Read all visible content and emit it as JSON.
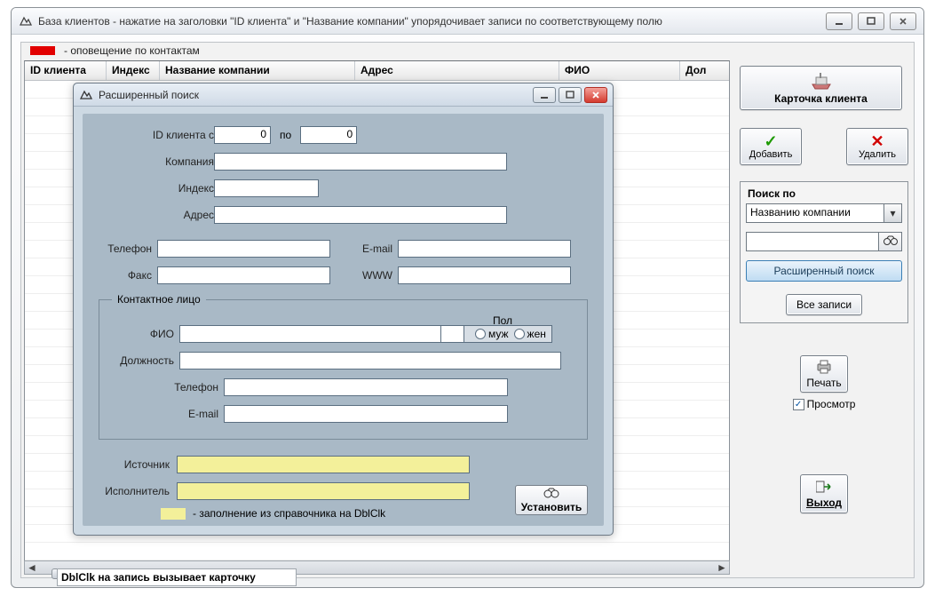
{
  "window": {
    "title": "База клиентов - нажатие на заголовки \"ID клиента\" и \"Название компании\" упорядочивает записи по соответствующему полю"
  },
  "legend": {
    "text": "- оповещение по контактам"
  },
  "grid": {
    "columns": [
      "ID клиента",
      "Индекс",
      "Название компании",
      "Адрес",
      "ФИО",
      "Дол"
    ],
    "widths": [
      92,
      60,
      220,
      230,
      136,
      55
    ]
  },
  "hint": "DblClk на запись вызывает карточку клиента",
  "sidebar": {
    "card": "Карточка клиента",
    "add": "Добавить",
    "delete": "Удалить",
    "search_title": "Поиск по",
    "search_select": "Названию компании",
    "ext_search": "Расширенный поиск",
    "all": "Все записи",
    "print": "Печать",
    "preview": "Просмотр",
    "exit": "Выход"
  },
  "modal": {
    "title": "Расширенный поиск",
    "id_from": "ID клиента с",
    "id_to": "по",
    "id_from_val": "0",
    "id_to_val": "0",
    "company": "Компания",
    "index": "Индекс",
    "address": "Адрес",
    "phone": "Телефон",
    "email": "E-mail",
    "fax": "Факс",
    "www": "WWW",
    "contact_legend": "Контактное лицо",
    "fio": "ФИО",
    "gender": "Пол",
    "male": "муж",
    "female": "жен",
    "position": "Должность",
    "c_phone": "Телефон",
    "c_email": "E-mail",
    "source": "Источник",
    "executor": "Исполнитель",
    "yellow_hint": "- заполнение из справочника на DblClk",
    "set": "Установить"
  }
}
